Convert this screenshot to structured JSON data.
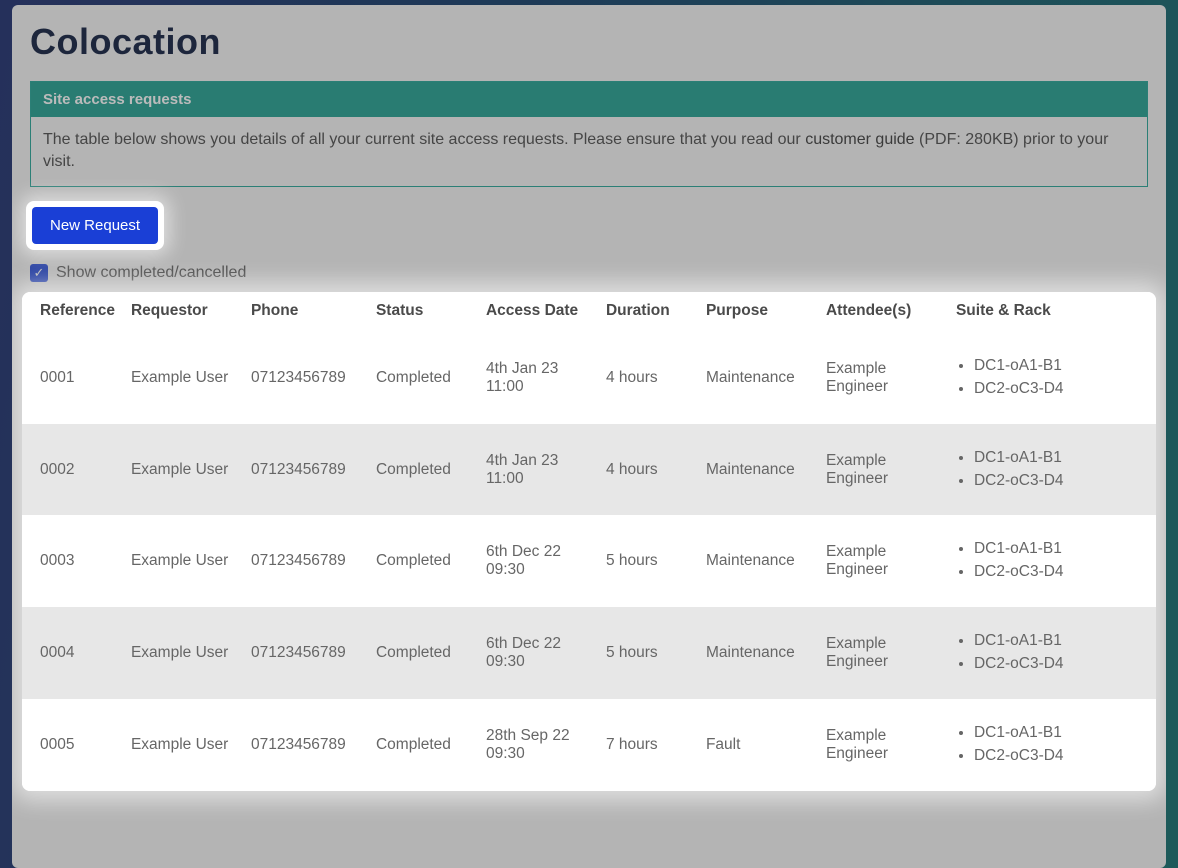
{
  "page": {
    "title": "Colocation"
  },
  "panel": {
    "heading": "Site access requests",
    "body_prefix": "The table below shows you details of all your current site access requests. Please ensure that you read our ",
    "link_text": "customer guide",
    "body_middle": " (PDF: 280KB)",
    "body_suffix": " prior to your visit."
  },
  "actions": {
    "new_request_label": "New Request"
  },
  "filter": {
    "show_completed_label": "Show completed/cancelled",
    "checked": true
  },
  "table": {
    "headers": {
      "reference": "Reference",
      "requestor": "Requestor",
      "phone": "Phone",
      "status": "Status",
      "access_date": "Access Date",
      "duration": "Duration",
      "purpose": "Purpose",
      "attendees": "Attendee(s)",
      "suite_rack": "Suite & Rack"
    },
    "rows": [
      {
        "reference": "0001",
        "requestor": "Example User",
        "phone": "07123456789",
        "status": "Completed",
        "access_date": "4th Jan 23",
        "access_time": "11:00",
        "duration": "4 hours",
        "purpose": "Maintenance",
        "attendees": "Example Engineer",
        "racks": [
          "DC1-oA1-B1",
          "DC2-oC3-D4"
        ]
      },
      {
        "reference": "0002",
        "requestor": "Example User",
        "phone": "07123456789",
        "status": "Completed",
        "access_date": "4th Jan 23",
        "access_time": "11:00",
        "duration": "4 hours",
        "purpose": "Maintenance",
        "attendees": "Example Engineer",
        "racks": [
          "DC1-oA1-B1",
          "DC2-oC3-D4"
        ]
      },
      {
        "reference": "0003",
        "requestor": "Example User",
        "phone": "07123456789",
        "status": "Completed",
        "access_date": "6th Dec 22",
        "access_time": "09:30",
        "duration": "5 hours",
        "purpose": "Maintenance",
        "attendees": "Example Engineer",
        "racks": [
          "DC1-oA1-B1",
          "DC2-oC3-D4"
        ]
      },
      {
        "reference": "0004",
        "requestor": "Example User",
        "phone": "07123456789",
        "status": "Completed",
        "access_date": "6th Dec 22",
        "access_time": "09:30",
        "duration": "5 hours",
        "purpose": "Maintenance",
        "attendees": "Example Engineer",
        "racks": [
          "DC1-oA1-B1",
          "DC2-oC3-D4"
        ]
      },
      {
        "reference": "0005",
        "requestor": "Example User",
        "phone": "07123456789",
        "status": "Completed",
        "access_date": "28th Sep 22",
        "access_time": "09:30",
        "duration": "7 hours",
        "purpose": "Fault",
        "attendees": "Example Engineer",
        "racks": [
          "DC1-oA1-B1",
          "DC2-oC3-D4"
        ]
      }
    ]
  }
}
